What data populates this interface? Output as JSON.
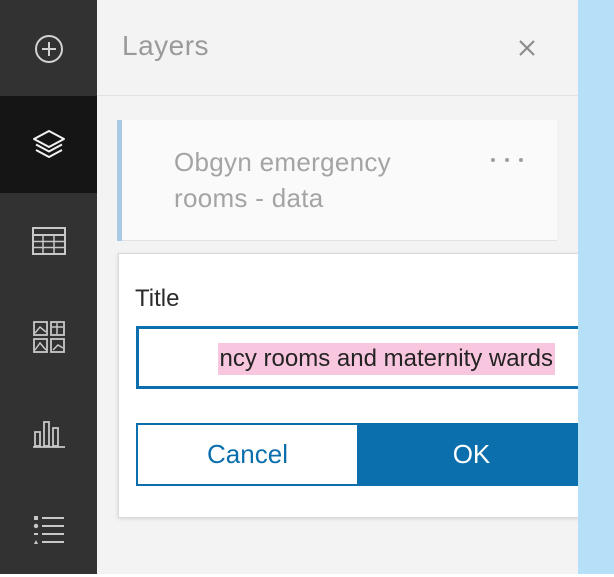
{
  "panel": {
    "title": "Layers",
    "close_icon": "close-icon"
  },
  "toolbar": {
    "items": [
      {
        "icon": "add-icon"
      },
      {
        "icon": "layers-icon",
        "active": true
      },
      {
        "icon": "table-icon"
      },
      {
        "icon": "basemap-gallery-icon"
      },
      {
        "icon": "charts-icon"
      },
      {
        "icon": "legend-icon"
      }
    ]
  },
  "layer": {
    "name": "Obgyn emergency rooms - data",
    "menu_icon": "more-options-icon"
  },
  "rename_popover": {
    "label": "Title",
    "input_value": "ncy rooms and maternity wards",
    "cancel_label": "Cancel",
    "ok_label": "OK"
  },
  "colors": {
    "accent": "#0b6fad",
    "toolbar_bg": "#323232",
    "toolbar_active_bg": "#151515",
    "selection_highlight": "#f9c6df",
    "map_water": "#b6e0f8"
  }
}
